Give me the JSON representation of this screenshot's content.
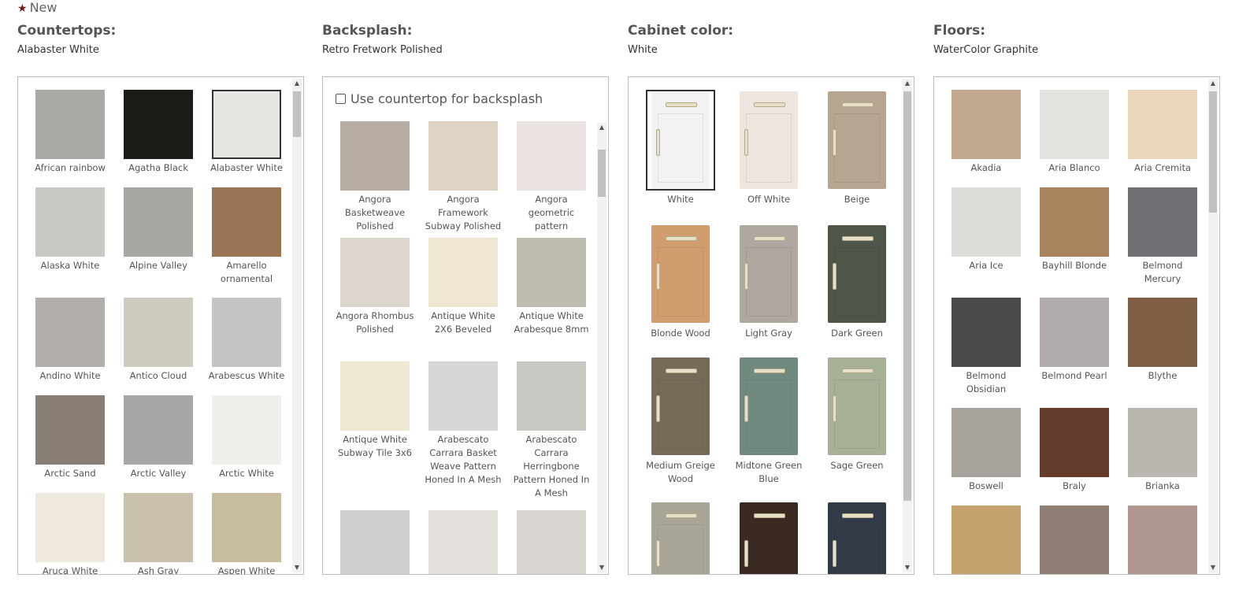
{
  "header": {
    "new_label": "New"
  },
  "countertops": {
    "title": "Countertops:",
    "selected": "Alabaster White",
    "items": [
      {
        "label": "African rainbow",
        "color": "#a9a9a6"
      },
      {
        "label": "Agatha Black",
        "color": "#1c1b18"
      },
      {
        "label": "Alabaster White",
        "color": "#e8e6e2"
      },
      {
        "label": "Alaska White",
        "color": "#c9c9c4"
      },
      {
        "label": "Alpine Valley",
        "color": "#a8a6a0"
      },
      {
        "label": "Amarello ornamental",
        "color": "#9a7555"
      },
      {
        "label": "Andino White",
        "color": "#b2aeaa"
      },
      {
        "label": "Antico Cloud",
        "color": "#cfcbc0"
      },
      {
        "label": "Arabescus White",
        "color": "#c4c4c6"
      },
      {
        "label": "Arctic Sand",
        "color": "#8a7f76"
      },
      {
        "label": "Arctic Valley",
        "color": "#a6a7a9"
      },
      {
        "label": "Arctic White",
        "color": "#f1efec"
      },
      {
        "label": "Aruca White",
        "color": "#efe9dd"
      },
      {
        "label": "Ash Gray",
        "color": "#cac0ae"
      },
      {
        "label": "Aspen White",
        "color": "#c8bc9f"
      }
    ]
  },
  "backsplash": {
    "title": "Backsplash:",
    "selected": "Retro Fretwork Polished",
    "checkbox_label": "Use countertop for backsplash",
    "items": [
      {
        "label": "Angora Basketweave Polished",
        "color": "#b7ada3"
      },
      {
        "label": "Angora Framework Subway Polished",
        "color": "#e0d3c6"
      },
      {
        "label": "Angora geometric pattern",
        "color": "#ece4e2"
      },
      {
        "label": "Angora Rhombus Polished",
        "color": "#dcd6cf"
      },
      {
        "label": "Antique White 2X6 Beveled",
        "color": "#efe7d2"
      },
      {
        "label": "Antique White Arabesque 8mm",
        "color": "#bdbcae"
      },
      {
        "label": "Antique White Subway Tile 3x6",
        "color": "#efe8d2"
      },
      {
        "label": "Arabescato Carrara Basket Weave Pattern Honed In A Mesh",
        "color": "#d6d6d4"
      },
      {
        "label": "Arabescato Carrara Herringbone Pattern Honed In A Mesh",
        "color": "#c8c8c3"
      },
      {
        "label": "",
        "color": "#cfcfcf"
      },
      {
        "label": "",
        "color": "#e4e0db"
      },
      {
        "label": "",
        "color": "#d9d6d1"
      }
    ]
  },
  "cabinet": {
    "title": "Cabinet color:",
    "selected": "White",
    "items": [
      {
        "label": "White",
        "color": "#f2f2f2"
      },
      {
        "label": "Off White",
        "color": "#ede5de"
      },
      {
        "label": "Beige",
        "color": "#b6a691"
      },
      {
        "label": "Blonde Wood",
        "color": "#d09e6e"
      },
      {
        "label": "Light Gray",
        "color": "#aea8a1"
      },
      {
        "label": "Dark Green",
        "color": "#4e5649"
      },
      {
        "label": "Medium Greige Wood",
        "color": "#776a58"
      },
      {
        "label": "Midtone Green Blue",
        "color": "#708a80"
      },
      {
        "label": "Sage Green",
        "color": "#a7b198"
      },
      {
        "label": "",
        "color": "#a9a697"
      },
      {
        "label": "",
        "color": "#3b2a22"
      },
      {
        "label": "",
        "color": "#333a48"
      }
    ]
  },
  "floors": {
    "title": "Floors:",
    "selected": "WaterColor Graphite",
    "items": [
      {
        "label": "Akadia",
        "color": "#c2a88e"
      },
      {
        "label": "Aria Blanco",
        "color": "#e2e2de"
      },
      {
        "label": "Aria Cremita",
        "color": "#ead6bb"
      },
      {
        "label": "Aria Ice",
        "color": "#dedcd8"
      },
      {
        "label": "Bayhill Blonde",
        "color": "#a9845f"
      },
      {
        "label": "Belmond Mercury",
        "color": "#707074"
      },
      {
        "label": "Belmond Obsidian",
        "color": "#4b4b4e"
      },
      {
        "label": "Belmond Pearl",
        "color": "#b1acab"
      },
      {
        "label": "Blythe",
        "color": "#7e5f44"
      },
      {
        "label": "Boswell",
        "color": "#a7a39c"
      },
      {
        "label": "Braly",
        "color": "#653c2c"
      },
      {
        "label": "Brianka",
        "color": "#b9b7b0"
      },
      {
        "label": "",
        "color": "#c4a36e"
      },
      {
        "label": "",
        "color": "#8f7e73"
      },
      {
        "label": "",
        "color": "#b09890"
      }
    ]
  },
  "icons": {
    "star": "star-icon",
    "up": "scroll-up-icon",
    "down": "scroll-down-icon"
  }
}
